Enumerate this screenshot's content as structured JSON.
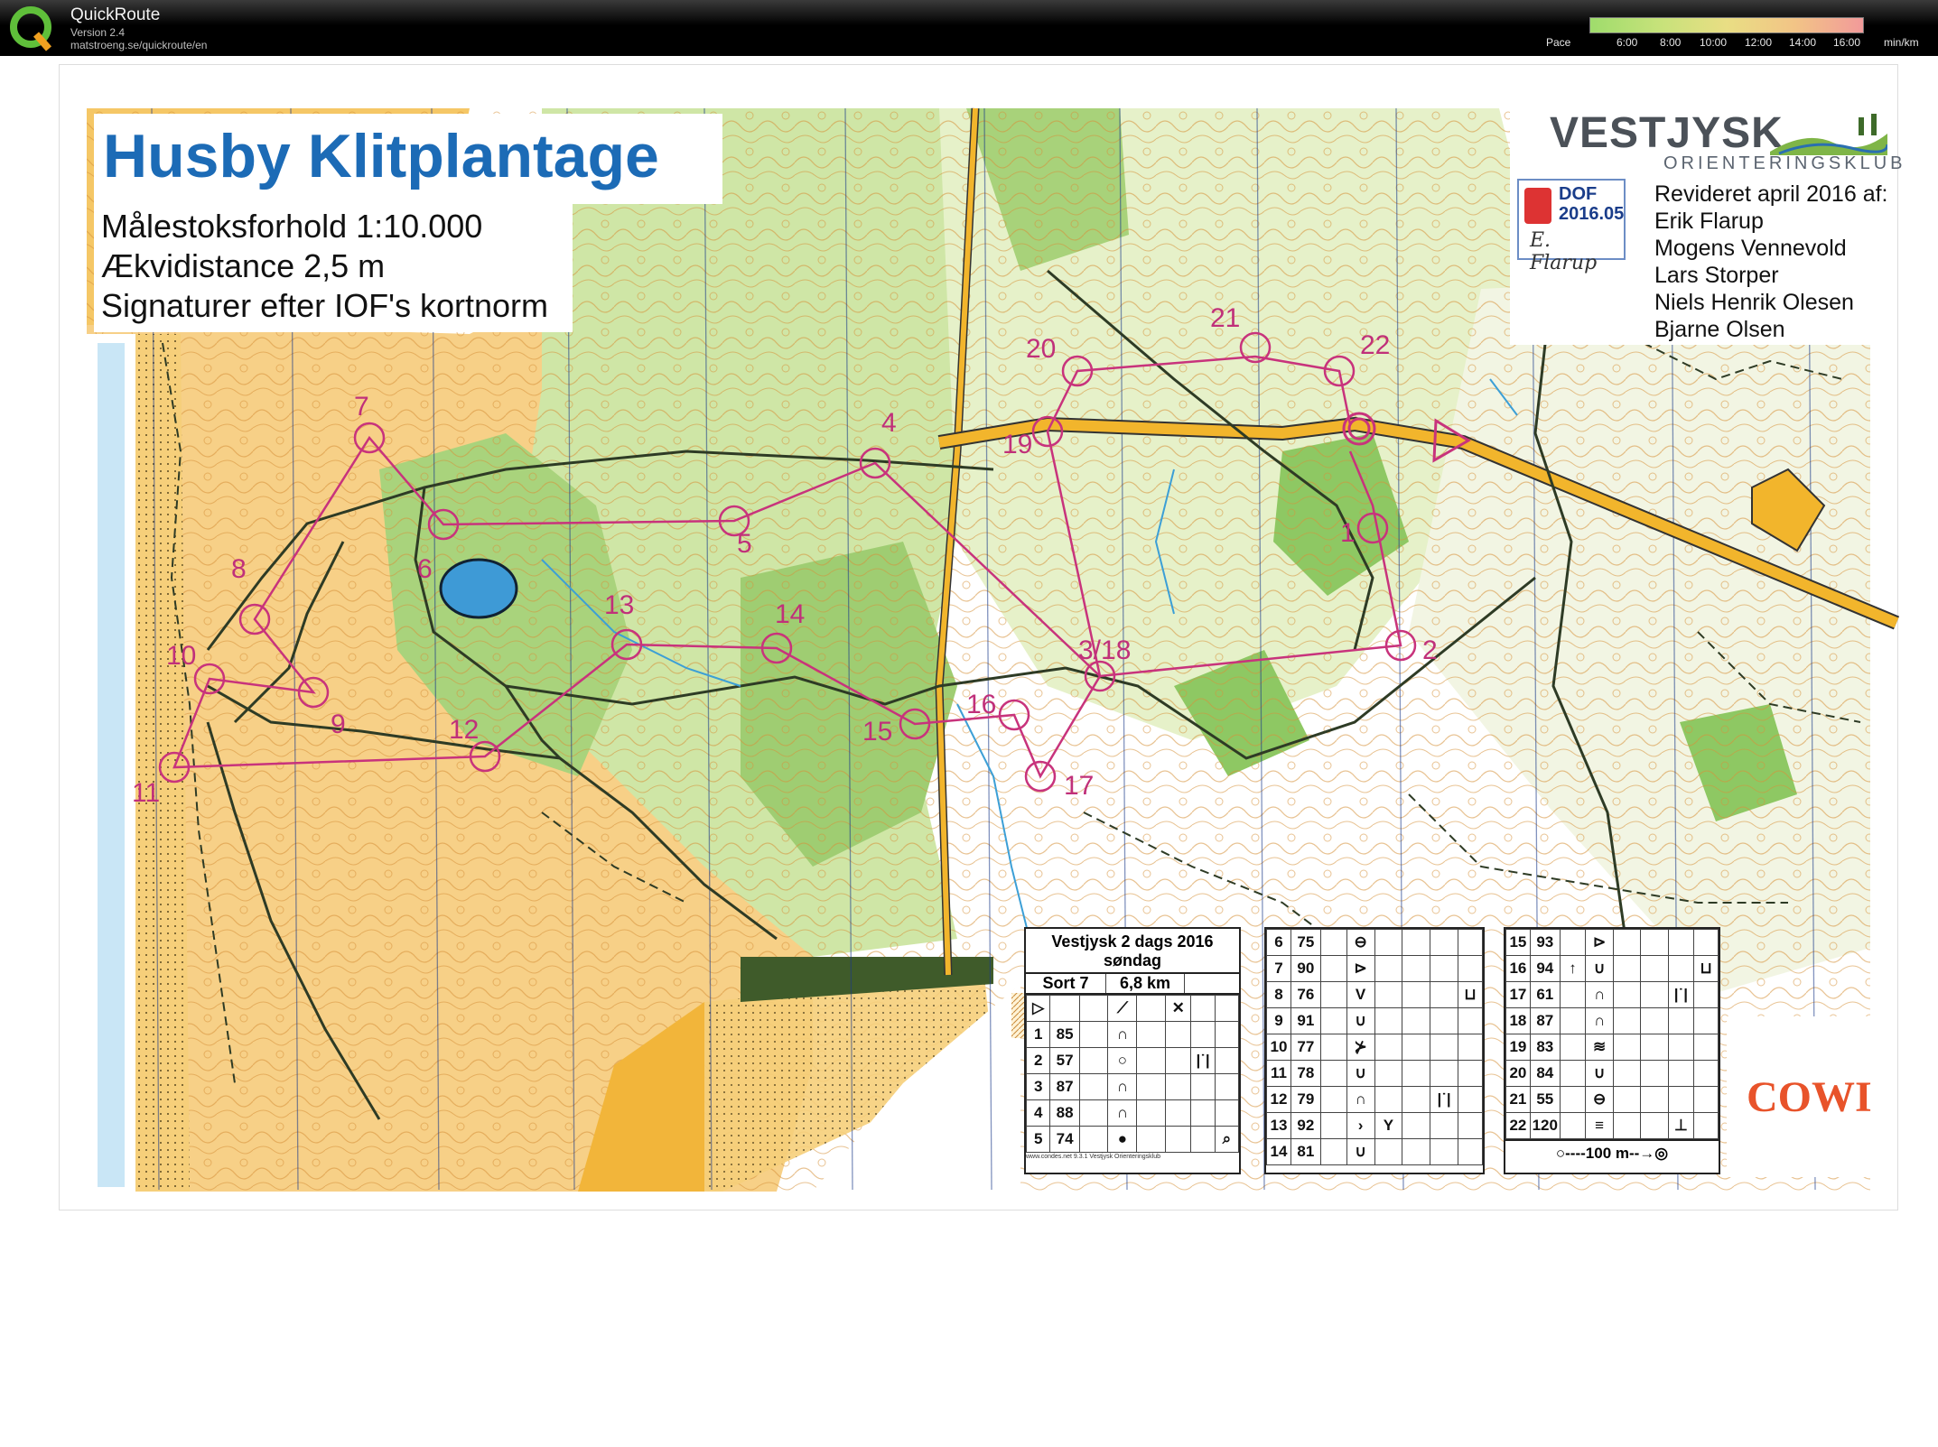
{
  "app": {
    "name": "QuickRoute",
    "version": "Version 2.4",
    "url": "matstroeng.se/quickroute/en"
  },
  "pace_scale": {
    "label": "Pace",
    "ticks": [
      "6:00",
      "8:00",
      "10:00",
      "12:00",
      "14:00",
      "16:00"
    ],
    "unit": "min/km",
    "colors": [
      "#9fdc6c",
      "#c6e27a",
      "#e9de84",
      "#f2c486",
      "#f29a9a"
    ]
  },
  "map": {
    "title": "Husby Klitplantage",
    "scale_line": "Målestoksforhold 1:10.000",
    "contour_line": "Ækvidistance 2,5 m",
    "norm_line": "Signaturer efter IOF's kortnorm",
    "club": {
      "name": "VESTJYSK",
      "subtitle": "ORIENTERINGSKLUB"
    },
    "dof": {
      "line1": "DOF",
      "line2": "2016.05",
      "signature": "E. Flarup"
    },
    "revision": {
      "heading": "Revideret april 2016 af:",
      "names": [
        "Erik Flarup",
        "Mogens Vennevold",
        "Lars Storper",
        "Niels Henrik Olesen",
        "Bjarne Olsen"
      ]
    },
    "sponsor": "COWI",
    "colors": {
      "course": "#c8337c",
      "sand": "#f4c25a",
      "forest": "#b6d98a",
      "track": "#2a3a25",
      "water": "#4aa7d8"
    },
    "controls": [
      {
        "label": "1"
      },
      {
        "label": "2"
      },
      {
        "label": "3/18"
      },
      {
        "label": "4"
      },
      {
        "label": "5"
      },
      {
        "label": "6"
      },
      {
        "label": "7"
      },
      {
        "label": "8"
      },
      {
        "label": "9"
      },
      {
        "label": "10"
      },
      {
        "label": "11"
      },
      {
        "label": "12"
      },
      {
        "label": "13"
      },
      {
        "label": "14"
      },
      {
        "label": "15"
      },
      {
        "label": "16"
      },
      {
        "label": "17"
      },
      {
        "label": "19"
      },
      {
        "label": "20"
      },
      {
        "label": "21"
      },
      {
        "label": "22"
      }
    ]
  },
  "description_sheet": {
    "event": "Vestjysk 2 dags 2016",
    "day": "søndag",
    "class": "Sort 7",
    "length": "6,8 km",
    "footer": "www.condes.net 9.3.1 Vestjysk Orienteringsklub",
    "finish_text": "100 m",
    "rows": [
      {
        "num": "1",
        "code": "85",
        "sym": "∩"
      },
      {
        "num": "2",
        "code": "57",
        "sym": "○"
      },
      {
        "num": "3",
        "code": "87",
        "sym": "∩"
      },
      {
        "num": "4",
        "code": "88",
        "sym": "∩"
      },
      {
        "num": "5",
        "code": "74",
        "sym": "●"
      },
      {
        "num": "6",
        "code": "75",
        "sym": "⊖"
      },
      {
        "num": "7",
        "code": "90",
        "sym": "⊳"
      },
      {
        "num": "8",
        "code": "76",
        "sym": "V"
      },
      {
        "num": "9",
        "code": "91",
        "sym": "∪"
      },
      {
        "num": "10",
        "code": "77",
        "sym": "⊁"
      },
      {
        "num": "11",
        "code": "78",
        "sym": "∪"
      },
      {
        "num": "12",
        "code": "79",
        "sym": "∩"
      },
      {
        "num": "13",
        "code": "92",
        "sym": "›"
      },
      {
        "num": "14",
        "code": "81",
        "sym": "∪"
      },
      {
        "num": "15",
        "code": "93",
        "sym": "⊳"
      },
      {
        "num": "16",
        "code": "94",
        "sym": "∪"
      },
      {
        "num": "17",
        "code": "61",
        "sym": "∩"
      },
      {
        "num": "18",
        "code": "87",
        "sym": "∩"
      },
      {
        "num": "19",
        "code": "83",
        "sym": "≋"
      },
      {
        "num": "20",
        "code": "84",
        "sym": "∪"
      },
      {
        "num": "21",
        "code": "55",
        "sym": "⊖"
      },
      {
        "num": "22",
        "code": "120",
        "sym": "≡"
      }
    ]
  }
}
